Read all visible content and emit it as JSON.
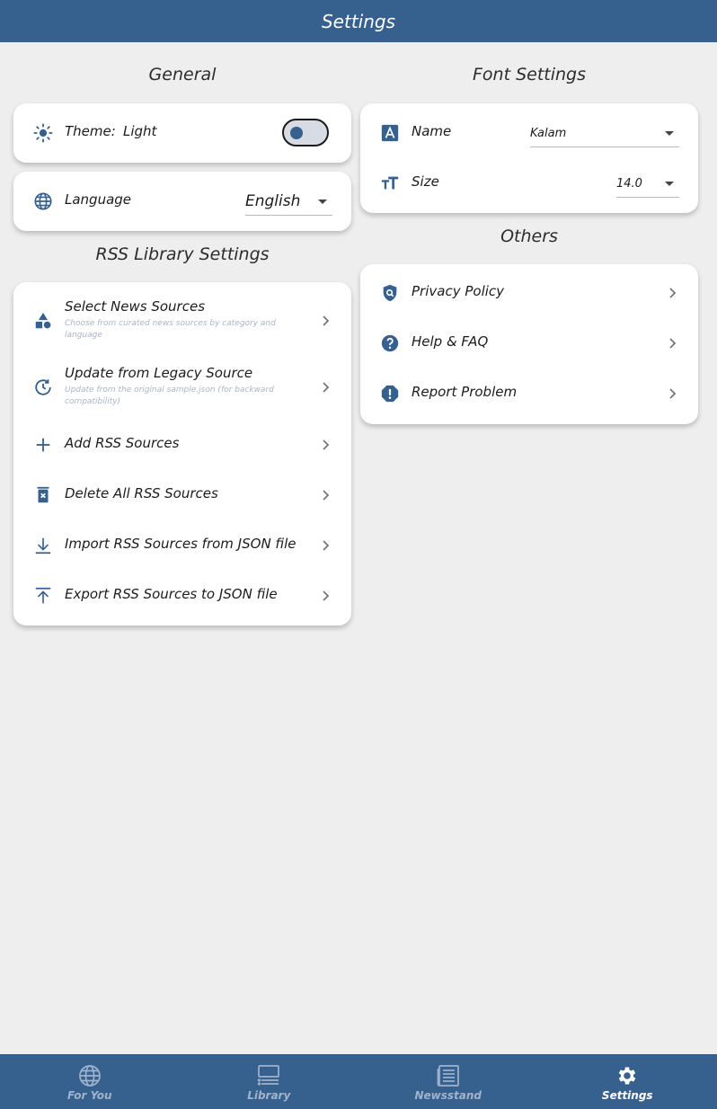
{
  "app_bar": {
    "title": "Settings"
  },
  "general": {
    "title": "General",
    "theme_label": "Theme:",
    "theme_value": "Light",
    "language_label": "Language",
    "language_value": "English"
  },
  "rss_library": {
    "title": "RSS Library Settings",
    "items": [
      {
        "label": "Select News Sources",
        "subtitle": "Choose from curated news sources by category and language"
      },
      {
        "label": "Update from Legacy Source",
        "subtitle": "Update from the original sample.json (for backward compatibility)"
      },
      {
        "label": "Add RSS Sources"
      },
      {
        "label": "Delete All RSS Sources"
      },
      {
        "label": "Import RSS Sources from JSON file"
      },
      {
        "label": "Export RSS Sources to JSON file"
      }
    ]
  },
  "font_settings": {
    "title": "Font Settings",
    "name_label": "Name",
    "name_value": "Kalam",
    "size_label": "Size",
    "size_value": "14.0"
  },
  "others": {
    "title": "Others",
    "items": [
      {
        "label": "Privacy Policy"
      },
      {
        "label": "Help & FAQ"
      },
      {
        "label": "Report Problem"
      }
    ]
  },
  "bottom_nav": {
    "items": [
      {
        "label": "For You"
      },
      {
        "label": "Library"
      },
      {
        "label": "Newsstand"
      },
      {
        "label": "Settings"
      }
    ]
  },
  "colors": {
    "primary": "#36618e",
    "background": "#eeeeee",
    "card": "#ffffff",
    "inactive_nav": "#9fb3cc"
  }
}
